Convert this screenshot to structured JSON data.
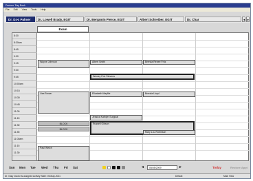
{
  "window": {
    "title": "Doctors' Day Book",
    "menu": [
      "File",
      "Edit",
      "View",
      "Tools",
      "Help"
    ]
  },
  "tabs": [
    {
      "label": "Dr. D.H. Palmer",
      "active": true
    },
    {
      "label": "Dr. Lowell Brady, EGIT",
      "active": false
    },
    {
      "label": "Dr. Benjamin Pierce, EGIT",
      "active": false
    },
    {
      "label": "Albert Schreiber, EGIT",
      "active": false
    },
    {
      "label": "Dr. Char",
      "active": false
    }
  ],
  "tab_nav": {
    "prev": "◄",
    "next": "►"
  },
  "column_header": "Exam",
  "times": [
    "8:30",
    "8:30am",
    "8:45",
    "9:00",
    "9:15",
    "9:30",
    "9:45",
    "10:00am",
    "10:15",
    "10:30",
    "10:45",
    "11:00",
    "11:15",
    "11:30",
    "11:45",
    "11:00am",
    "11:15",
    "11:30"
  ],
  "appointments": {
    "a1": "Wayne Johnson",
    "a2": "Albert Smith",
    "a3": "Brenda Renee Fritz",
    "a4": "Wesley Eric Stevens",
    "a5": "Lisa Brown",
    "a6": "Elizabeth Mayfile",
    "a7": "Brenda Lloyd",
    "a8": "Jessica Kathlyn Surgical",
    "a9": "Russell Gibson",
    "a10": "Mary Lou Robinson",
    "a11": "Paul Welch"
  },
  "blocks": {
    "b1": "BLOCK",
    "b2": "BLOCK"
  },
  "toolbar": {
    "days": [
      "Sun",
      "Mon",
      "Tue",
      "Wed",
      "Thu",
      "Fri",
      "Sat"
    ],
    "date": "05/05/2009",
    "prev": "◄",
    "next": "►",
    "today_label": "Today",
    "restore_label": "Restore Appt"
  },
  "status": {
    "message": "Dr. Gary Doctor is assigned Activity Slate: 05-May-2011",
    "mode": "Default",
    "view": "Main View"
  },
  "colors": {
    "title_bar": "#2a3d8f",
    "active_tab": "#1f2d6e",
    "today": "#d03030",
    "dot_yellow": "#f0d020",
    "dot_white": "#ffffff",
    "dot_black": "#111111",
    "dot_gray": "#888888"
  }
}
